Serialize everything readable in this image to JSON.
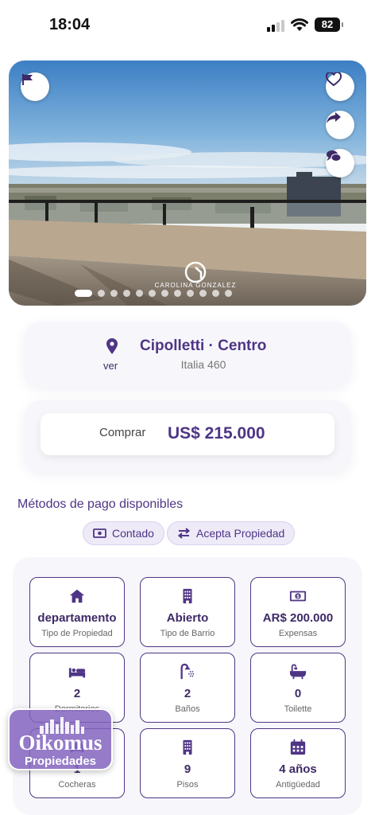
{
  "status_bar": {
    "time": "18:04",
    "battery": "82"
  },
  "hero": {
    "watermark": "CAROLINA GONZALEZ",
    "slide_count": 12,
    "active_slide": 0
  },
  "location": {
    "ver": "ver",
    "city": "Cipolletti · Centro",
    "street": "Italia 460"
  },
  "price": {
    "label": "Comprar",
    "value": "US$ 215.000"
  },
  "payment": {
    "title": "Métodos de pago disponibles",
    "methods": [
      "Contado",
      "Acepta Propiedad"
    ]
  },
  "features": [
    {
      "icon": "home-icon",
      "value": "departamento",
      "label": "Tipo de Propiedad"
    },
    {
      "icon": "building-icon",
      "value": "Abierto",
      "label": "Tipo de Barrio"
    },
    {
      "icon": "money-icon",
      "value": "AR$ 200.000",
      "label": "Expensas"
    },
    {
      "icon": "bed-icon",
      "value": "2",
      "label": "Dormitorios"
    },
    {
      "icon": "shower-icon",
      "value": "2",
      "label": "Baños"
    },
    {
      "icon": "bathtub-icon",
      "value": "0",
      "label": "Toilette"
    },
    {
      "icon": "car-icon",
      "value": "1",
      "label": "Cocheras"
    },
    {
      "icon": "building-icon",
      "value": "9",
      "label": "Pisos"
    },
    {
      "icon": "calendar-icon",
      "value": "4 años",
      "label": "Antigüedad"
    }
  ],
  "brand": {
    "name": "Oikomus",
    "sub": "Propiedades"
  },
  "colors": {
    "accent": "#4e3585",
    "chip_bg": "#eeeaf8",
    "card_bg": "#f7f7fb"
  }
}
